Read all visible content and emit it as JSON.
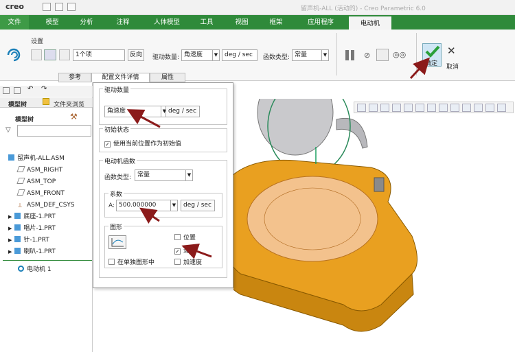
{
  "app": {
    "logo": "creo",
    "title": "留声机-ALL (活动的) - Creo Parametric 6.0"
  },
  "menu": [
    "文件",
    "模型",
    "分析",
    "注释",
    "人体模型",
    "工具",
    "视图",
    "框架",
    "应用程序",
    "电动机"
  ],
  "ribbon": {
    "settings_label": "设置",
    "reference_value": "1个项",
    "reverse_button": "反向",
    "driven_qty_label": "驱动数量:",
    "driven_qty_value": "角速度",
    "units": "deg / sec",
    "func_type_label": "函数类型:",
    "func_type_value": "常量",
    "ok_label": "确定",
    "cancel_label": "取消",
    "tabs": [
      "参考",
      "配置文件详情",
      "属性"
    ]
  },
  "left_panel": {
    "tab_model_tree": "模型树",
    "tab_folder": "文件夹浏览",
    "tree_title": "模型树",
    "items": [
      "留声机-ALL.ASM",
      "ASM_RIGHT",
      "ASM_TOP",
      "ASM_FRONT",
      "ASM_DEF_CSYS",
      "底座-1.PRT",
      "唱片-1.PRT",
      "针-1.PRT",
      "喇叭-1.PRT"
    ],
    "motor_item": "电动机 1"
  },
  "dialog": {
    "driven_qty_group": "驱动数量",
    "driven_qty_value": "角速度",
    "units": "deg / sec",
    "init_state_group": "初始状态",
    "init_state_option": "使用当前位置作为初始值",
    "motor_func_group": "电动机函数",
    "func_type_label": "函数类型:",
    "func_type_value": "常量",
    "coef_group": "系数",
    "coef_label": "A:",
    "coef_value": "500.000000",
    "coef_units": "deg / sec",
    "graph_group": "图形",
    "position_label": "位置",
    "velocity_label": "速度",
    "accel_label": "加速度",
    "single_graph_label": "在单独图形中"
  },
  "colors": {
    "menu_green": "#2f8a3a",
    "model_orange": "#e9a020",
    "arrow": "#8b1a1a",
    "ok_green": "#2aa03a"
  }
}
